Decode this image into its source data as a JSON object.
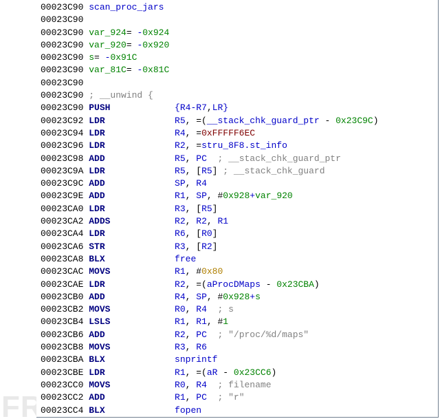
{
  "watermark": "FREEBUF",
  "colors": {
    "blue": "#0000c8",
    "keyword": "#000080",
    "string": "#008200",
    "number": "#008200",
    "autoname": "#af7f00",
    "comment": "#808080",
    "macro": "#7f0000",
    "default": "#000000"
  },
  "lines": [
    {
      "addr": "00023C90",
      "cols": [
        {
          "t": "scan_proc_jars",
          "c": "blue"
        }
      ]
    },
    {
      "addr": "00023C90",
      "cols": []
    },
    {
      "addr": "00023C90",
      "cols": [
        {
          "t": "var_924",
          "c": "string"
        },
        {
          "t": "= ",
          "c": "default"
        },
        {
          "t": "-",
          "c": "blue"
        },
        {
          "t": "0x924",
          "c": "number"
        }
      ]
    },
    {
      "addr": "00023C90",
      "cols": [
        {
          "t": "var_920",
          "c": "string"
        },
        {
          "t": "= ",
          "c": "default"
        },
        {
          "t": "-",
          "c": "blue"
        },
        {
          "t": "0x920",
          "c": "number"
        }
      ]
    },
    {
      "addr": "00023C90",
      "cols": [
        {
          "t": "s",
          "c": "string"
        },
        {
          "t": "= ",
          "c": "default"
        },
        {
          "t": "-",
          "c": "blue"
        },
        {
          "t": "0x91C",
          "c": "number"
        }
      ]
    },
    {
      "addr": "00023C90",
      "cols": [
        {
          "t": "var_81C",
          "c": "string"
        },
        {
          "t": "= ",
          "c": "default"
        },
        {
          "t": "-",
          "c": "blue"
        },
        {
          "t": "0x81C",
          "c": "number"
        }
      ]
    },
    {
      "addr": "00023C90",
      "cols": []
    },
    {
      "addr": "00023C90",
      "cols": [
        {
          "t": "; __unwind {",
          "c": "comment"
        }
      ]
    },
    {
      "addr": "00023C90",
      "cols": [
        {
          "t": "PUSH",
          "c": "keyword",
          "w": 16
        },
        {
          "t": "{R4",
          "c": "blue"
        },
        {
          "t": "-",
          "c": "blue"
        },
        {
          "t": "R7",
          "c": "blue"
        },
        {
          "t": ",",
          "c": "default"
        },
        {
          "t": "LR",
          "c": "blue"
        },
        {
          "t": "}",
          "c": "blue"
        }
      ]
    },
    {
      "addr": "00023C92",
      "cols": [
        {
          "t": "LDR",
          "c": "keyword",
          "w": 16
        },
        {
          "t": "R5",
          "c": "blue"
        },
        {
          "t": ", =(",
          "c": "default"
        },
        {
          "t": "__stack_chk_guard_ptr",
          "c": "blue"
        },
        {
          "t": " - ",
          "c": "default"
        },
        {
          "t": "0x23C9C",
          "c": "number"
        },
        {
          "t": ")",
          "c": "default"
        }
      ]
    },
    {
      "addr": "00023C94",
      "cols": [
        {
          "t": "LDR",
          "c": "keyword",
          "w": 16
        },
        {
          "t": "R4",
          "c": "blue"
        },
        {
          "t": ", =",
          "c": "default"
        },
        {
          "t": "0xFFFFF6EC",
          "c": "macro"
        }
      ]
    },
    {
      "addr": "00023C96",
      "cols": [
        {
          "t": "LDR",
          "c": "keyword",
          "w": 16
        },
        {
          "t": "R2",
          "c": "blue"
        },
        {
          "t": ", =",
          "c": "default"
        },
        {
          "t": "stru_8F8.st_info",
          "c": "blue"
        }
      ]
    },
    {
      "addr": "00023C98",
      "cols": [
        {
          "t": "ADD",
          "c": "keyword",
          "w": 16
        },
        {
          "t": "R5",
          "c": "blue"
        },
        {
          "t": ", ",
          "c": "default"
        },
        {
          "t": "PC",
          "c": "blue"
        },
        {
          "t": "  ",
          "c": "default"
        },
        {
          "t": "; __stack_chk_guard_ptr",
          "c": "comment"
        }
      ]
    },
    {
      "addr": "00023C9A",
      "cols": [
        {
          "t": "LDR",
          "c": "keyword",
          "w": 16
        },
        {
          "t": "R5",
          "c": "blue"
        },
        {
          "t": ", [",
          "c": "default"
        },
        {
          "t": "R5",
          "c": "blue"
        },
        {
          "t": "] ",
          "c": "default"
        },
        {
          "t": "; __stack_chk_guard",
          "c": "comment"
        }
      ]
    },
    {
      "addr": "00023C9C",
      "cols": [
        {
          "t": "ADD",
          "c": "keyword",
          "w": 16
        },
        {
          "t": "SP",
          "c": "blue"
        },
        {
          "t": ", ",
          "c": "default"
        },
        {
          "t": "R4",
          "c": "blue"
        }
      ]
    },
    {
      "addr": "00023C9E",
      "cols": [
        {
          "t": "ADD",
          "c": "keyword",
          "w": 16
        },
        {
          "t": "R1",
          "c": "blue"
        },
        {
          "t": ", ",
          "c": "default"
        },
        {
          "t": "SP",
          "c": "blue"
        },
        {
          "t": ", #",
          "c": "default"
        },
        {
          "t": "0x928",
          "c": "number"
        },
        {
          "t": "+",
          "c": "blue"
        },
        {
          "t": "var_920",
          "c": "string"
        }
      ]
    },
    {
      "addr": "00023CA0",
      "cols": [
        {
          "t": "LDR",
          "c": "keyword",
          "w": 16
        },
        {
          "t": "R3",
          "c": "blue"
        },
        {
          "t": ", [",
          "c": "default"
        },
        {
          "t": "R5",
          "c": "blue"
        },
        {
          "t": "]",
          "c": "default"
        }
      ]
    },
    {
      "addr": "00023CA2",
      "cols": [
        {
          "t": "ADDS",
          "c": "keyword",
          "w": 16
        },
        {
          "t": "R2",
          "c": "blue"
        },
        {
          "t": ", ",
          "c": "default"
        },
        {
          "t": "R2",
          "c": "blue"
        },
        {
          "t": ", ",
          "c": "default"
        },
        {
          "t": "R1",
          "c": "blue"
        }
      ]
    },
    {
      "addr": "00023CA4",
      "cols": [
        {
          "t": "LDR",
          "c": "keyword",
          "w": 16
        },
        {
          "t": "R6",
          "c": "blue"
        },
        {
          "t": ", [",
          "c": "default"
        },
        {
          "t": "R0",
          "c": "blue"
        },
        {
          "t": "]",
          "c": "default"
        }
      ]
    },
    {
      "addr": "00023CA6",
      "cols": [
        {
          "t": "STR",
          "c": "keyword",
          "w": 16
        },
        {
          "t": "R3",
          "c": "blue"
        },
        {
          "t": ", [",
          "c": "default"
        },
        {
          "t": "R2",
          "c": "blue"
        },
        {
          "t": "]",
          "c": "default"
        }
      ]
    },
    {
      "addr": "00023CA8",
      "cols": [
        {
          "t": "BLX",
          "c": "keyword",
          "w": 16
        },
        {
          "t": "free",
          "c": "blue"
        }
      ]
    },
    {
      "addr": "00023CAC",
      "cols": [
        {
          "t": "MOVS",
          "c": "keyword",
          "w": 16
        },
        {
          "t": "R1",
          "c": "blue"
        },
        {
          "t": ", #",
          "c": "default"
        },
        {
          "t": "0x80",
          "c": "autoname"
        }
      ]
    },
    {
      "addr": "00023CAE",
      "cols": [
        {
          "t": "LDR",
          "c": "keyword",
          "w": 16
        },
        {
          "t": "R2",
          "c": "blue"
        },
        {
          "t": ", =(",
          "c": "default"
        },
        {
          "t": "aProcDMaps",
          "c": "blue"
        },
        {
          "t": " - ",
          "c": "default"
        },
        {
          "t": "0x23CBA",
          "c": "number"
        },
        {
          "t": ")",
          "c": "default"
        }
      ]
    },
    {
      "addr": "00023CB0",
      "cols": [
        {
          "t": "ADD",
          "c": "keyword",
          "w": 16
        },
        {
          "t": "R4",
          "c": "blue"
        },
        {
          "t": ", ",
          "c": "default"
        },
        {
          "t": "SP",
          "c": "blue"
        },
        {
          "t": ", #",
          "c": "default"
        },
        {
          "t": "0x928",
          "c": "number"
        },
        {
          "t": "+",
          "c": "blue"
        },
        {
          "t": "s",
          "c": "string"
        }
      ]
    },
    {
      "addr": "00023CB2",
      "cols": [
        {
          "t": "MOVS",
          "c": "keyword",
          "w": 16
        },
        {
          "t": "R0",
          "c": "blue"
        },
        {
          "t": ", ",
          "c": "default"
        },
        {
          "t": "R4",
          "c": "blue"
        },
        {
          "t": "  ",
          "c": "default"
        },
        {
          "t": "; s",
          "c": "comment"
        }
      ]
    },
    {
      "addr": "00023CB4",
      "cols": [
        {
          "t": "LSLS",
          "c": "keyword",
          "w": 16
        },
        {
          "t": "R1",
          "c": "blue"
        },
        {
          "t": ", ",
          "c": "default"
        },
        {
          "t": "R1",
          "c": "blue"
        },
        {
          "t": ", #",
          "c": "default"
        },
        {
          "t": "1",
          "c": "number"
        }
      ]
    },
    {
      "addr": "00023CB6",
      "cols": [
        {
          "t": "ADD",
          "c": "keyword",
          "w": 16
        },
        {
          "t": "R2",
          "c": "blue"
        },
        {
          "t": ", ",
          "c": "default"
        },
        {
          "t": "PC",
          "c": "blue"
        },
        {
          "t": "  ",
          "c": "default"
        },
        {
          "t": "; \"/proc/%d/maps\"",
          "c": "comment"
        }
      ]
    },
    {
      "addr": "00023CB8",
      "cols": [
        {
          "t": "MOVS",
          "c": "keyword",
          "w": 16
        },
        {
          "t": "R3",
          "c": "blue"
        },
        {
          "t": ", ",
          "c": "default"
        },
        {
          "t": "R6",
          "c": "blue"
        }
      ]
    },
    {
      "addr": "00023CBA",
      "cols": [
        {
          "t": "BLX",
          "c": "keyword",
          "w": 16
        },
        {
          "t": "snprintf",
          "c": "blue"
        }
      ]
    },
    {
      "addr": "00023CBE",
      "cols": [
        {
          "t": "LDR",
          "c": "keyword",
          "w": 16
        },
        {
          "t": "R1",
          "c": "blue"
        },
        {
          "t": ", =(",
          "c": "default"
        },
        {
          "t": "aR",
          "c": "blue"
        },
        {
          "t": " - ",
          "c": "default"
        },
        {
          "t": "0x23CC6",
          "c": "number"
        },
        {
          "t": ")",
          "c": "default"
        }
      ]
    },
    {
      "addr": "00023CC0",
      "cols": [
        {
          "t": "MOVS",
          "c": "keyword",
          "w": 16
        },
        {
          "t": "R0",
          "c": "blue"
        },
        {
          "t": ", ",
          "c": "default"
        },
        {
          "t": "R4",
          "c": "blue"
        },
        {
          "t": "  ",
          "c": "default"
        },
        {
          "t": "; filename",
          "c": "comment"
        }
      ]
    },
    {
      "addr": "00023CC2",
      "cols": [
        {
          "t": "ADD",
          "c": "keyword",
          "w": 16
        },
        {
          "t": "R1",
          "c": "blue"
        },
        {
          "t": ", ",
          "c": "default"
        },
        {
          "t": "PC",
          "c": "blue"
        },
        {
          "t": "  ",
          "c": "default"
        },
        {
          "t": "; \"r\"",
          "c": "comment"
        }
      ]
    },
    {
      "addr": "00023CC4",
      "cols": [
        {
          "t": "BLX",
          "c": "keyword",
          "w": 16
        },
        {
          "t": "fopen",
          "c": "blue"
        }
      ]
    }
  ]
}
